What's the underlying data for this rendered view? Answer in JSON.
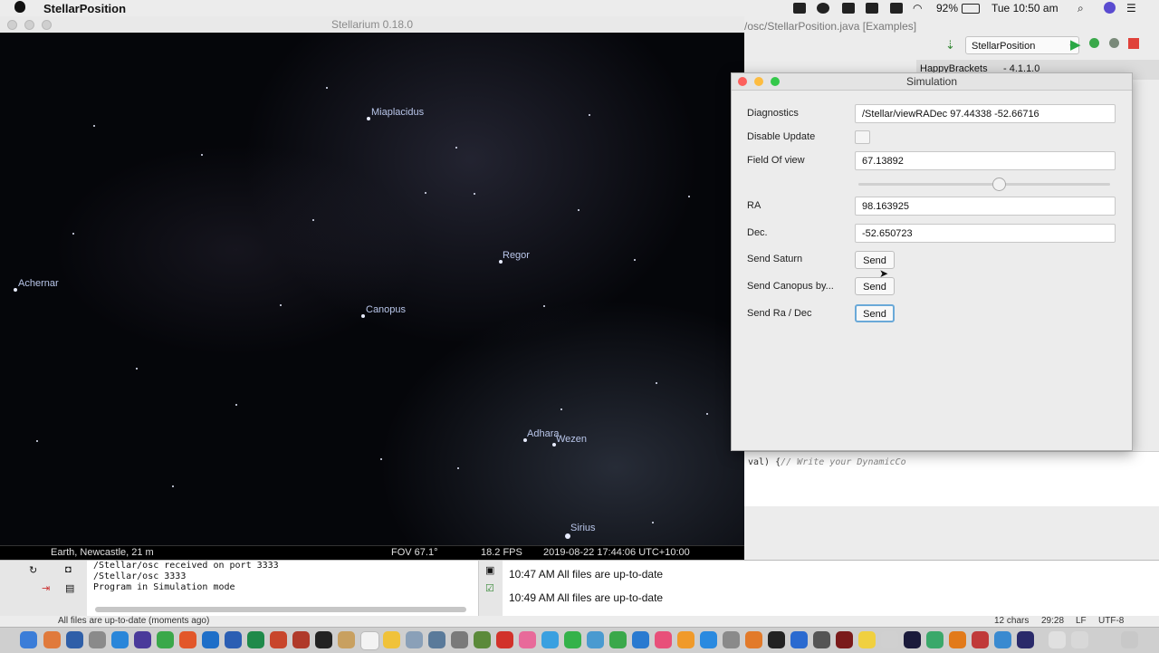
{
  "menubar": {
    "app_name": "StellarPosition",
    "battery": "92%",
    "clock": "Tue 10:50 am"
  },
  "ide": {
    "title": "/osc/StellarPosition.java [Examples]",
    "run_config": "StellarPosition",
    "tab_label": "HappyBrackets",
    "tab_version": "- 4.1.1.0",
    "code_prefix": "val) {",
    "code_comment": "// Write your DynamicCo"
  },
  "stellarium": {
    "title": "Stellarium 0.18.0",
    "labels": {
      "miaplacidus": "Miaplacidus",
      "achernar": "Achernar",
      "regor": "Regor",
      "canopus": "Canopus",
      "adhara": "Adhara",
      "wezen": "Wezen",
      "sirius": "Sirius"
    },
    "status": {
      "location": "Earth, Newcastle, 21 m",
      "fov": "FOV 67.1°",
      "fps": "18.2 FPS",
      "datetime": "2019-08-22 17:44:06 UTC+10:00"
    }
  },
  "simulation": {
    "title": "Simulation",
    "diagnostics_label": "Diagnostics",
    "diagnostics_value": "/Stellar/viewRADec 97.44338 -52.66716",
    "disable_update_label": "Disable Update",
    "disable_update_checked": false,
    "fov_label": "Field Of view",
    "fov_value": "67.13892",
    "fov_slider_fraction": 0.56,
    "ra_label": "RA",
    "ra_value": "98.163925",
    "dec_label": "Dec.",
    "dec_value": "-52.650723",
    "send_saturn_label": "Send Saturn",
    "send_canopus_label": "Send Canopus by...",
    "send_radec_label": "Send Ra / Dec",
    "send_button": "Send"
  },
  "console": {
    "lines": [
      "/Stellar/osc received on port 3333",
      "/Stellar/osc 3333",
      "Program in Simulation mode"
    ]
  },
  "event_log": {
    "lines": [
      "10:47 AM All files are up-to-date",
      "10:49 AM All files are up-to-date"
    ]
  },
  "ide_status": {
    "message": "All files are up-to-date (moments ago)",
    "chars": "12 chars",
    "position": "29:28",
    "line_sep": "LF",
    "encoding": "UTF-8"
  },
  "colors": {
    "close": "#fc605c",
    "minimize": "#fdbc40",
    "zoom": "#34c84a",
    "focus_ring": "#6aa9d8",
    "sky": "#05060a",
    "star_label": "#b9c6ea"
  }
}
